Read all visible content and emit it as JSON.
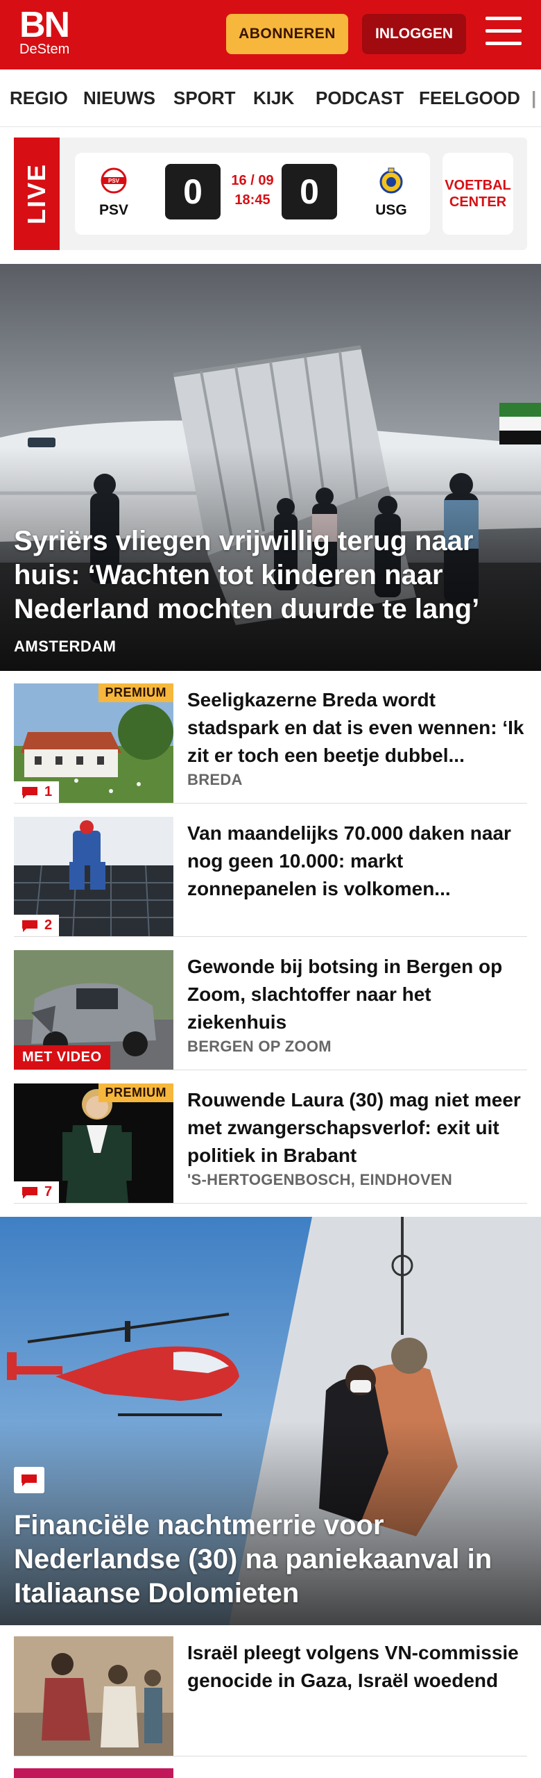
{
  "header": {
    "logo_main": "BN",
    "logo_sub": "DeStem",
    "subscribe_label": "ABONNEREN",
    "login_label": "INLOGGEN",
    "brand_color": "#d70f14"
  },
  "nav": {
    "items": [
      "REGIO",
      "NIEUWS",
      "SPORT",
      "KIJK",
      "PODCAST",
      "FEELGOOD"
    ]
  },
  "live": {
    "label": "LIVE",
    "home_team": "PSV",
    "away_team": "USG",
    "home_score": "0",
    "away_score": "0",
    "date": "16 / 09",
    "time": "18:45",
    "voetbal_center": "VOETBAL CENTER"
  },
  "hero": {
    "title": "Syriërs vliegen vrijwillig terug naar huis: ‘Wachten tot kinderen naar Nederland mochten duurde te lang’",
    "location": "AMSTERDAM"
  },
  "articles": [
    {
      "title": "Seeligkazerne Breda wordt stadspark en dat is even wennen: ‘Ik zit er toch een beetje dubbel...",
      "location": "BREDA",
      "premium": "PREMIUM",
      "comments": "1"
    },
    {
      "title": "Van maandelijks 70.000 daken naar nog geen 10.000: markt zonnepanelen is volkomen...",
      "comments": "2"
    },
    {
      "title": "Gewonde bij botsing in Bergen op Zoom, slachtoffer naar het ziekenhuis",
      "location": "BERGEN OP ZOOM",
      "video": "MET VIDEO"
    },
    {
      "title": "Rouwende Laura (30) mag niet meer met zwangerschapsverlof: exit uit politiek in Brabant",
      "location": "'S-HERTOGENBOSCH, EINDHOVEN",
      "premium": "PREMIUM",
      "comments": "7"
    }
  ],
  "hero2": {
    "title": "Financiële nachtmerrie voor Nederlandse (30) na paniekaanval in Italiaanse Dolomieten"
  },
  "article_bottom": {
    "title": "Israël pleegt volgens VN-commissie genocide in Gaza, Israël woedend"
  }
}
